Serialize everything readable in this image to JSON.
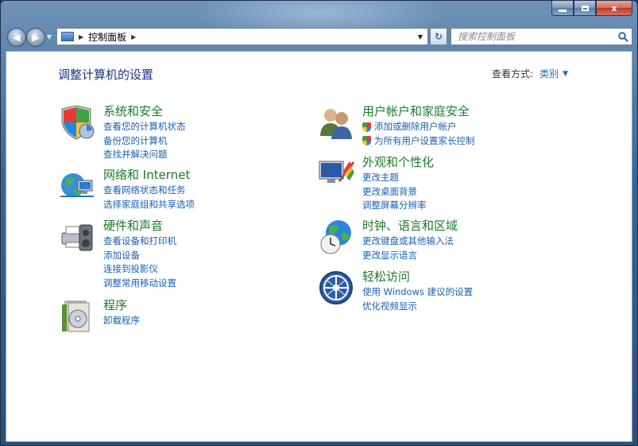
{
  "window": {
    "minimize_glyph": "minimize",
    "maximize_glyph": "maximize",
    "close_label": "x"
  },
  "nav": {
    "breadcrumb": [
      "控制面板"
    ],
    "search_placeholder": "搜索控制面板"
  },
  "main": {
    "title": "调整计算机的设置",
    "view_by_label": "查看方式:",
    "view_by_value": "类别"
  },
  "categories_left": [
    {
      "title": "系统和安全",
      "icon": "shield-icon",
      "links": [
        "查看您的计算机状态",
        "备份您的计算机",
        "查找并解决问题"
      ]
    },
    {
      "title": "网络和 Internet",
      "icon": "network-icon",
      "links": [
        "查看网络状态和任务",
        "选择家庭组和共享选项"
      ]
    },
    {
      "title": "硬件和声音",
      "icon": "printer-icon",
      "links": [
        "查看设备和打印机",
        "添加设备",
        "连接到投影仪",
        "调整常用移动设置"
      ]
    },
    {
      "title": "程序",
      "icon": "programs-icon",
      "links": [
        "卸载程序"
      ]
    }
  ],
  "categories_right": [
    {
      "title": "用户帐户和家庭安全",
      "icon": "users-icon",
      "links": [
        "添加或删除用户帐户",
        "为所有用户设置家长控制"
      ],
      "shielded": [
        true,
        true
      ]
    },
    {
      "title": "外观和个性化",
      "icon": "appearance-icon",
      "links": [
        "更改主题",
        "更改桌面背景",
        "调整屏幕分辨率"
      ]
    },
    {
      "title": "时钟、语言和区域",
      "icon": "clock-globe-icon",
      "links": [
        "更改键盘或其他输入法",
        "更改显示语言"
      ]
    },
    {
      "title": "轻松访问",
      "icon": "ease-of-access-icon",
      "links": [
        "使用 Windows 建议的设置",
        "优化视频显示"
      ]
    }
  ],
  "colors": {
    "title": "#1e3287",
    "category": "#1c7a2c",
    "link": "#1a5fb4"
  }
}
